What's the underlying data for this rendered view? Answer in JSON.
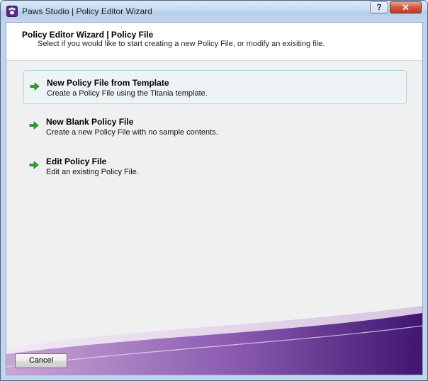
{
  "window": {
    "title": "Paws Studio | Policy Editor Wizard",
    "help_label": "?",
    "close_label": "✕"
  },
  "header": {
    "title": "Policy Editor Wizard | Policy File",
    "subtitle": "Select if you would like to start creating a new Policy File, or modify an exisiting file."
  },
  "options": [
    {
      "title": "New Policy File from Template",
      "description": "Create a Policy File using the Titania template.",
      "icon": "green-arrow-icon"
    },
    {
      "title": "New Blank Policy File",
      "description": "Create a new Policy File with no sample contents.",
      "icon": "green-arrow-icon"
    },
    {
      "title": "Edit Policy File",
      "description": "Edit an existing Policy File.",
      "icon": "green-arrow-icon"
    }
  ],
  "footer": {
    "cancel_label": "Cancel"
  },
  "colors": {
    "accent_purple": "#5b2a86",
    "arrow_green": "#2ea52e",
    "selection_border": "#a9dbe6"
  }
}
